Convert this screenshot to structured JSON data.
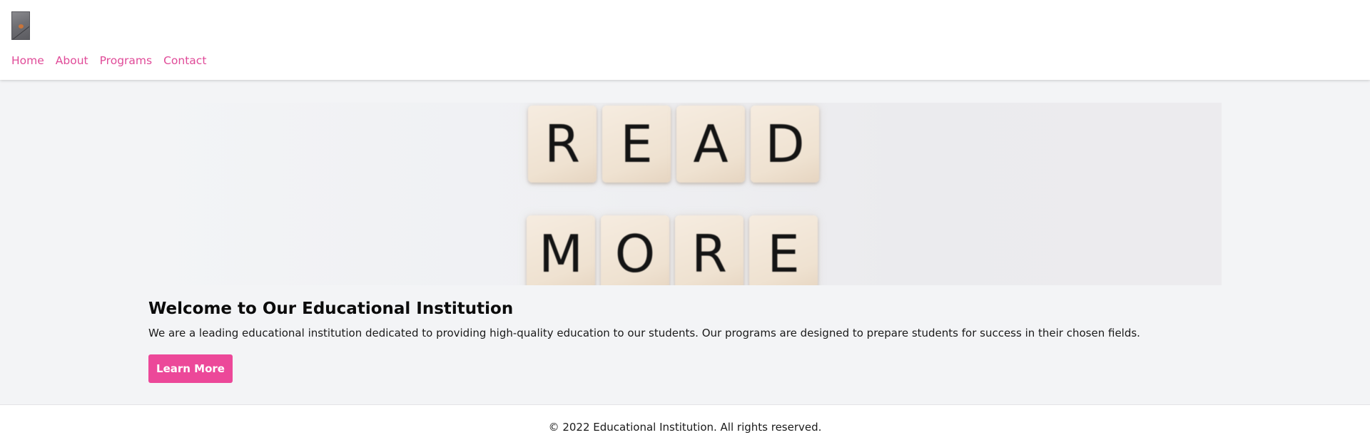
{
  "header": {
    "nav": [
      "Home",
      "About",
      "Programs",
      "Contact"
    ]
  },
  "hero": {
    "top_word": [
      "R",
      "E",
      "A",
      "D"
    ],
    "bottom_word": [
      "M",
      "O",
      "R",
      "E"
    ]
  },
  "main": {
    "title": "Welcome to Our Educational Institution",
    "description": "We are a leading educational institution dedicated to providing high-quality education to our students. Our programs are designed to prepare students for success in their chosen fields.",
    "cta_label": "Learn More"
  },
  "footer": {
    "text": "© 2022 Educational Institution. All rights reserved."
  },
  "colors": {
    "accent": "#ec4899",
    "nav_link": "#e04a98",
    "main_bg": "#f3f4f6"
  }
}
